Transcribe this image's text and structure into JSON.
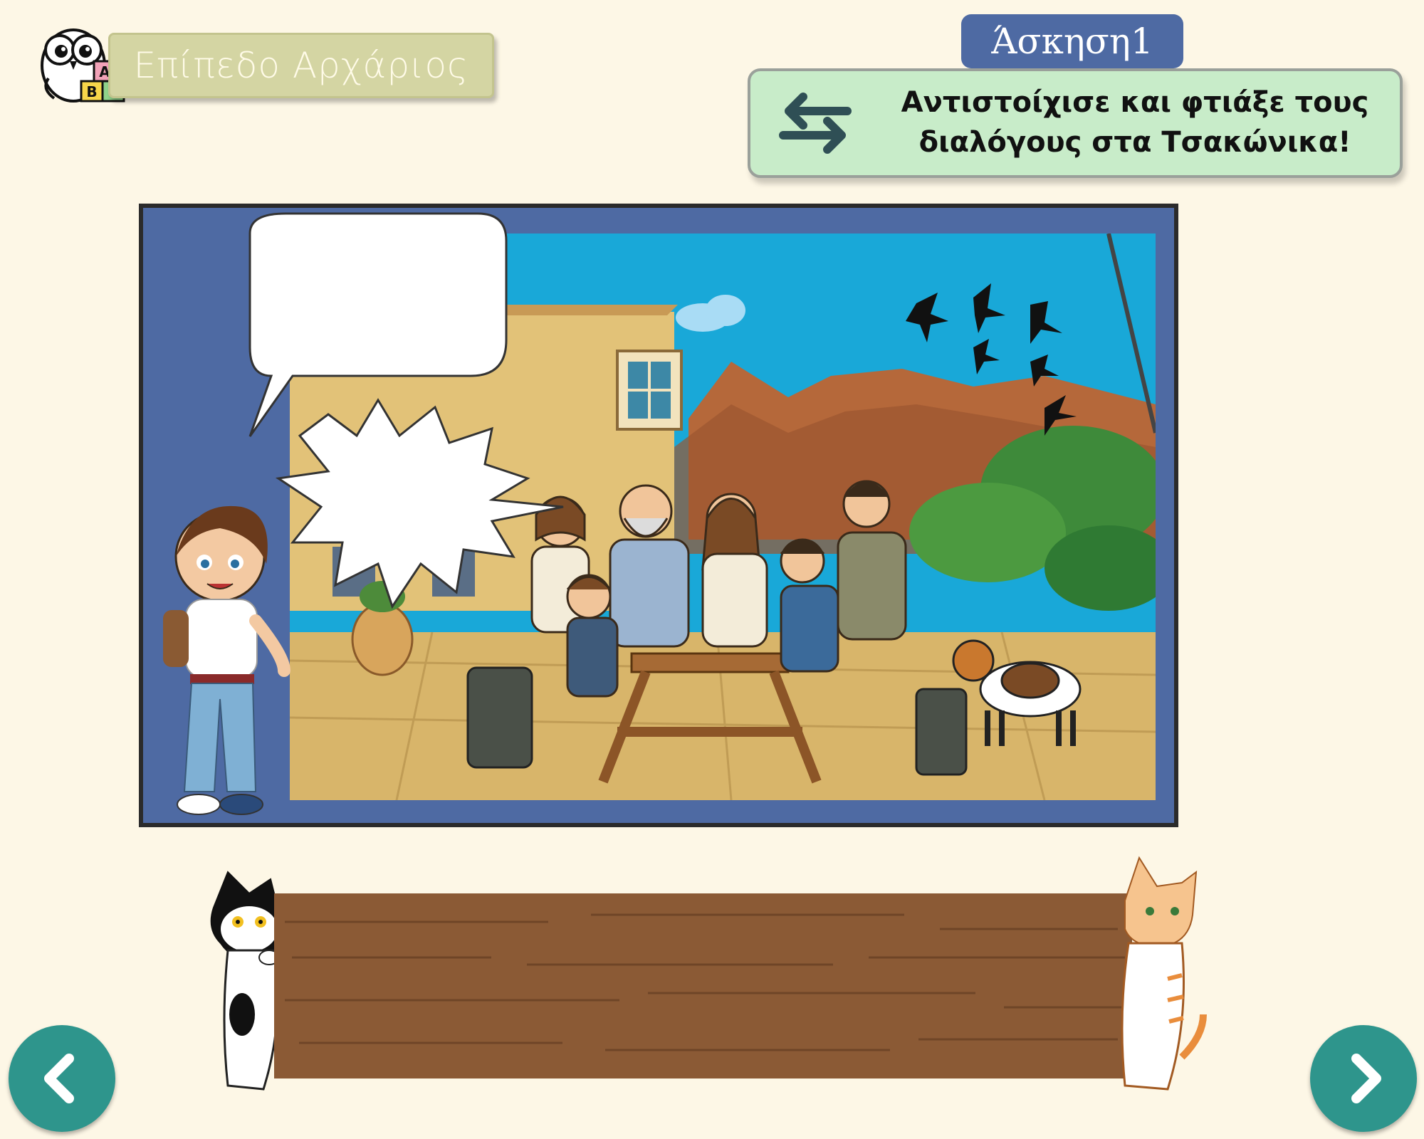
{
  "header": {
    "level_label": "Επίπεδο Αρχάριος",
    "logo_letters": [
      "Α",
      "Β",
      "Γ"
    ]
  },
  "exercise": {
    "label": "Άσκηση1",
    "instruction_line1": "Αντιστοίχισε και φτιάξε τους",
    "instruction_line2": "διαλόγους στα Τσακώνικα!",
    "icon": "swap-arrows-icon"
  },
  "scene": {
    "speech_bubble_1": "",
    "speech_bubble_2": ""
  },
  "answer_plank": {
    "text": ""
  },
  "navigation": {
    "prev_icon": "chevron-left-icon",
    "next_icon": "chevron-right-icon"
  },
  "colors": {
    "background": "#fdf7e6",
    "frame_blue": "#4e6aa3",
    "instruction_green": "#c8ecc9",
    "nav_teal": "#2e958c",
    "plank_brown": "#8b5a35"
  }
}
